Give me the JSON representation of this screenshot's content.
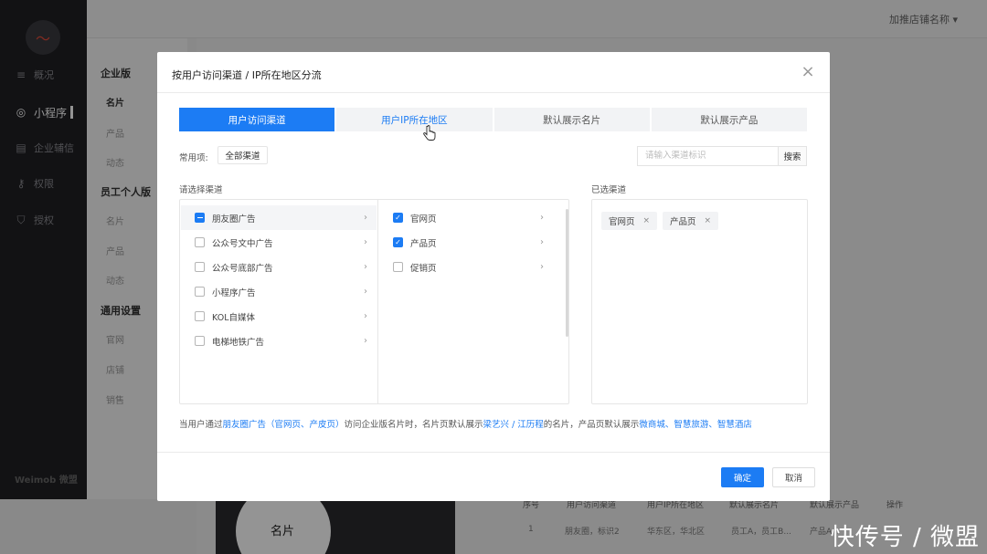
{
  "background": {
    "store_name": "加推店铺名称",
    "nav": [
      {
        "label": "概况",
        "icon": "chart-icon"
      },
      {
        "label": "小程序",
        "icon": "compass-icon",
        "active": true
      },
      {
        "label": "企业辅信",
        "icon": "building-icon"
      },
      {
        "label": "权限",
        "icon": "key-icon"
      },
      {
        "label": "授权",
        "icon": "shield-icon"
      }
    ],
    "brand": "Weimob 微盟",
    "groups": [
      {
        "title": "企业版",
        "items": [
          "名片",
          "产品",
          "动态"
        ]
      },
      {
        "title": "员工个人版",
        "items": [
          "名片",
          "产品",
          "动态"
        ]
      },
      {
        "title": "通用设置",
        "items": [
          "官网",
          "店铺",
          "销售"
        ]
      }
    ],
    "card_label": "名片",
    "table_headers": [
      "序号",
      "用户访问渠道",
      "用户IP所在地区",
      "默认展示名片",
      "默认展示产品",
      "操作"
    ],
    "table_row": [
      "1",
      "朋友圈，标识2",
      "华东区，华北区",
      "员工A，员工B...",
      "产品A..."
    ]
  },
  "modal": {
    "title": "按用户访问渠道 / IP所在地区分流",
    "tabs": [
      "用户访问渠道",
      "用户IP所在地区",
      "默认展示名片",
      "默认展示产品"
    ],
    "active_tab": 0,
    "common_label": "常用项:",
    "common_chip": "全部渠道",
    "search_placeholder": "请输入渠道标识",
    "search_button": "搜索",
    "select_label": "请选择渠道",
    "selected_label": "已选渠道",
    "channels": [
      {
        "label": "朋友圈广告",
        "state": "indeterminate",
        "highlight": true
      },
      {
        "label": "公众号文中广告",
        "state": "unchecked"
      },
      {
        "label": "公众号底部广告",
        "state": "unchecked"
      },
      {
        "label": "小程序广告",
        "state": "unchecked"
      },
      {
        "label": "KOL自媒体",
        "state": "unchecked"
      },
      {
        "label": "电梯地铁广告",
        "state": "unchecked"
      }
    ],
    "sub_channels": [
      {
        "label": "官网页",
        "state": "checked"
      },
      {
        "label": "产品页",
        "state": "checked"
      },
      {
        "label": "促销页",
        "state": "unchecked"
      }
    ],
    "selected_tags": [
      "官网页",
      "产品页"
    ],
    "hint": {
      "p1": "当用户通过",
      "link1": "朋友圈广告（官网页、产皮页）",
      "p2": "访问企业版名片时，名片页默认展示",
      "link2": "梁艺兴 / 江历程",
      "p3": "的名片，产品页默认展示",
      "link3": "微商城、智慧旅游、智慧酒店"
    },
    "ok_button": "确定",
    "cancel_button": "取消"
  },
  "watermark": "快传号 / 微盟",
  "colors": {
    "accent": "#1c7cf4",
    "sidebar": "#1f1f24"
  }
}
